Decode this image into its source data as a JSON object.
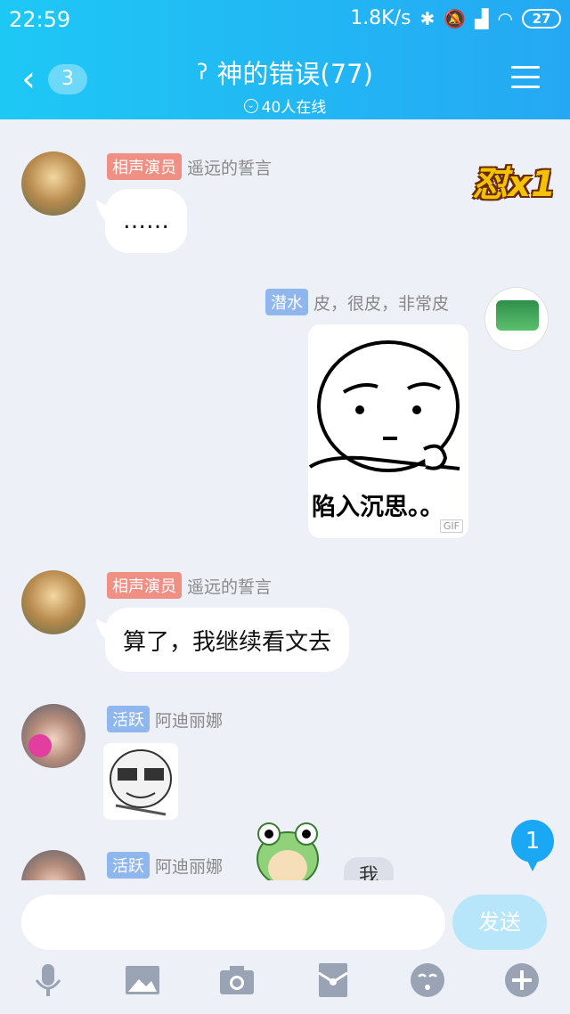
{
  "status_bar": {
    "time": "22:59",
    "net_speed": "1.8K/s",
    "battery": "27"
  },
  "header": {
    "back_count": "3",
    "title": "神的错误(77)",
    "online": "40人在线"
  },
  "messages": [
    {
      "badge": "相声演员",
      "name": "遥远的誓言",
      "text": "……"
    },
    {
      "badge": "潜水",
      "name": "皮，很皮，非常皮",
      "gif_caption": "陷入沉思。。",
      "gif_tag": "GIF"
    },
    {
      "badge": "相声演员",
      "name": "遥远的誓言",
      "text": "算了，我继续看文去"
    },
    {
      "badge": "活跃",
      "name": "阿迪丽娜"
    },
    {
      "badge": "活跃",
      "name": "阿迪丽娜"
    }
  ],
  "sticker_badge": "怼x1",
  "unread_count": "1",
  "self_bubble": "我",
  "composer": {
    "input_value": "",
    "send_label": "发送"
  },
  "colors": {
    "header_start": "#1ec8f5",
    "header_end": "#25a8f3",
    "badge_red": "#f08f84",
    "badge_blue": "#8fb7ee",
    "send_button": "#b7e6fb"
  },
  "icons": [
    "microphone-icon",
    "image-icon",
    "camera-icon",
    "red-packet-icon",
    "emoji-icon",
    "plus-icon"
  ]
}
